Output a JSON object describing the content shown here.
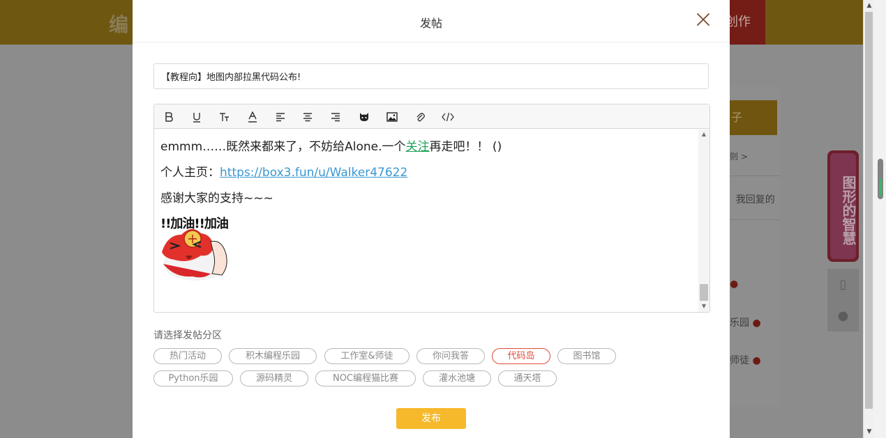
{
  "background": {
    "logo_text": "编",
    "create_label": "创作",
    "side_button_label": "子",
    "side_texts": [
      "则 >",
      "我回复的",
      "乐园",
      "师徒"
    ],
    "banner_text": "图形的智慧"
  },
  "modal": {
    "title": "发帖",
    "post_title_value": "【教程向】地图内部拉黑代码公布!",
    "editor": {
      "line1_before": "emmm……既然来都来了，不妨给Alone.一个",
      "line1_highlight": "关注",
      "line1_after": "再走吧！！ ()",
      "line2_prefix": "个人主页：",
      "line2_link": "https://box3.fun/u/Walker47622",
      "line3": "感谢大家的支持~~~",
      "sticker_text": "!!加油!!加油"
    },
    "toolbar_icons": [
      "bold-icon",
      "underline-icon",
      "font-size-icon",
      "font-color-icon",
      "align-left-icon",
      "align-center-icon",
      "align-right-icon",
      "emoji-cat-icon",
      "image-icon",
      "attachment-icon",
      "code-icon"
    ],
    "section_label": "请选择发帖分区",
    "tags": [
      {
        "label": "热门活动",
        "active": false
      },
      {
        "label": "积木编程乐园",
        "active": false
      },
      {
        "label": "工作室&师徒",
        "active": false
      },
      {
        "label": "你问我答",
        "active": false
      },
      {
        "label": "代码岛",
        "active": true
      },
      {
        "label": "图书馆",
        "active": false
      },
      {
        "label": "Python乐园",
        "active": false
      },
      {
        "label": "源码精灵",
        "active": false
      },
      {
        "label": "NOC编程猫比赛",
        "active": false
      },
      {
        "label": "灌水池塘",
        "active": false
      },
      {
        "label": "通天塔",
        "active": false
      }
    ],
    "publish_label": "发布"
  },
  "colors": {
    "accent": "#f6b92b",
    "active_tag": "#e14b3b",
    "link": "#3a97d2",
    "highlight": "#1fa35a"
  }
}
